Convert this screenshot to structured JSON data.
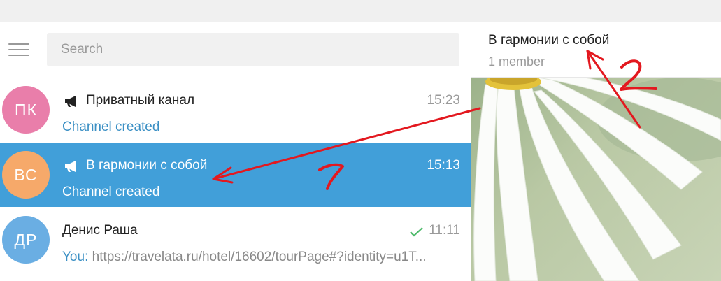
{
  "search": {
    "placeholder": "Search"
  },
  "chats": [
    {
      "initials": "ПК",
      "name": "Приватный канал",
      "time": "15:23",
      "preview": "Channel created",
      "avatar_color": "#e97eaa",
      "is_channel": true,
      "active": false
    },
    {
      "initials": "ВС",
      "name": "В гармонии с собой",
      "time": "15:13",
      "preview": "Channel created",
      "avatar_color": "#f6a96a",
      "is_channel": true,
      "active": true
    },
    {
      "initials": "ДР",
      "name": "Денис Раша",
      "time": "11:11",
      "preview_sender": "You:",
      "preview": " https://travelata.ru/hotel/16602/tourPage#?identity=u1T...",
      "avatar_color": "#6aaee3",
      "is_channel": false,
      "active": false,
      "read": true
    }
  ],
  "header": {
    "title": "В гармонии с собой",
    "subtitle": "1 member"
  },
  "annotations": {
    "label_1": "1",
    "label_2": "2",
    "color": "#e3181f"
  },
  "colors": {
    "accent": "#419fd9",
    "check": "#4dba6a"
  },
  "icons": {
    "menu": "hamburger-menu-icon",
    "channel": "megaphone-icon",
    "read": "double-check-icon"
  }
}
